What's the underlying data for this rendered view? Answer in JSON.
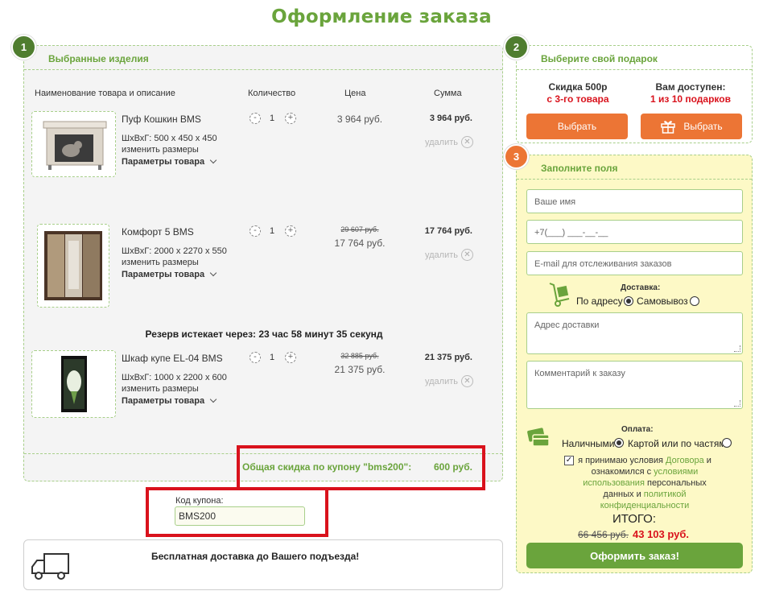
{
  "page_title": "Оформление заказа",
  "steps": {
    "s1": "1",
    "s2": "2",
    "s3": "3"
  },
  "cart": {
    "title": "Выбранные изделия",
    "columns": {
      "name": "Наименование товара и описание",
      "qty": "Количество",
      "price": "Цена",
      "sum": "Сумма"
    },
    "items": [
      {
        "name": "Пуф Кошкин BMS",
        "dims": "ШхВхГ: 500 х 450 х 450",
        "resize": "изменить размеры",
        "params": "Параметры товара",
        "qty": "1",
        "old_price": "",
        "price": "3 964 руб.",
        "sum": "3 964 руб.",
        "remove": "удалить"
      },
      {
        "name": "Комфорт 5 BMS",
        "dims": "ШхВхГ: 2000 х 2270 х 550",
        "resize": "изменить размеры",
        "params": "Параметры товара",
        "qty": "1",
        "old_price": "29 607 руб.",
        "price": "17 764 руб.",
        "sum": "17 764 руб.",
        "remove": "удалить"
      },
      {
        "name": "Шкаф купе EL-04 BMS",
        "dims": "ШхВхГ: 1000 х 2200 х 600",
        "resize": "изменить размеры",
        "params": "Параметры товара",
        "qty": "1",
        "old_price": "32 885 руб.",
        "price": "21 375 руб.",
        "sum": "21 375 руб.",
        "remove": "удалить"
      }
    ],
    "reserve_text": "Резерв истекает через: 23 час 58 минут 35 секунд",
    "discount_label": "Общая скидка по купону \"bms200\":",
    "discount_value": "600 руб.",
    "qty_minus": "-",
    "qty_plus": "+"
  },
  "coupon": {
    "label": "Код купона:",
    "value": "BMS200"
  },
  "delivery_banner": "Бесплатная доставка до Вашего подъезда!",
  "gift": {
    "title": "Выберите свой подарок",
    "left_title": "Скидка 500р",
    "left_sub": "с 3-го товара",
    "right_title": "Вам доступен:",
    "right_sub": "1 из 10 подарков",
    "button": "Выбрать"
  },
  "form": {
    "title": "Заполните поля",
    "name_placeholder": "Ваше имя",
    "phone_placeholder": "+7(___) ___-__-__",
    "email_placeholder": "E-mail для отслеживания заказов",
    "delivery_label": "Доставка:",
    "delivery_opt1": "По адресу",
    "delivery_opt2": "Самовывоз",
    "address_placeholder": "Адрес доставки",
    "comment_placeholder": "Комментарий к заказу",
    "payment_label": "Оплата:",
    "pay_opt1": "Наличными",
    "pay_opt2": "Картой или по частям",
    "terms_1": "я принимаю условия",
    "terms_contract": "Договора",
    "terms_2": "и ознакомился с",
    "terms_usage": "условиями использования",
    "terms_3": "персональных данных и",
    "terms_policy": "политикой конфиденциальности",
    "total_label": "ИТОГО:",
    "total_old": "66 456 руб.",
    "total_new": "43 103 руб.",
    "submit": "Оформить заказ!",
    "checkbox_mark": "✓"
  },
  "colors": {
    "green": "#6aa43c",
    "dark_green": "#4f7d2f",
    "orange": "#ec7535",
    "red": "#d9121c",
    "form_bg": "#fdf9c6"
  },
  "icons": [
    "truck-icon",
    "gift-icon",
    "hand-truck-icon",
    "card-icon",
    "close-circle-icon",
    "chevron-down-icon"
  ]
}
